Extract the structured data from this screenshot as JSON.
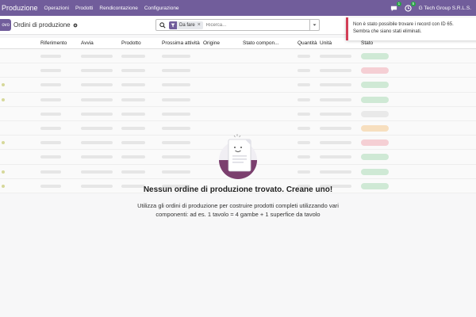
{
  "nav": {
    "app_name": "Produzione",
    "menu": [
      "Operazioni",
      "Prodotti",
      "Rendicontazione",
      "Configurazione"
    ],
    "chat_badge": "1",
    "activity_badge": "5",
    "company": "G Tech Group S.R.L.S."
  },
  "control": {
    "new_label": "ovo",
    "page_title": "Ordini di produzione",
    "facet_label": "Da fare",
    "search_placeholder": "Ricerca..."
  },
  "table": {
    "columns": [
      "Riferimento",
      "Avvia",
      "Prodotto",
      "Prossima attività",
      "Origine",
      "Stato compon...",
      "Quantità",
      "Unità",
      "Stato"
    ]
  },
  "empty": {
    "title": "Nessun ordine di produzione trovato. Creane uno!",
    "line1": "Utilizza gli ordini di produzione per costruire prodotti completi utilizzando vari",
    "line2": "componenti: ad es. 1 tavolo = 4 gambe + 1 superfice da tavolo"
  },
  "toast": {
    "line1": "Non è stato possibile trovare i record con ID 65.",
    "line2": "Sembra che siano stati eliminati."
  },
  "colors": {
    "brand": "#715d9b",
    "success": "#28a745",
    "danger": "#d23f57"
  }
}
